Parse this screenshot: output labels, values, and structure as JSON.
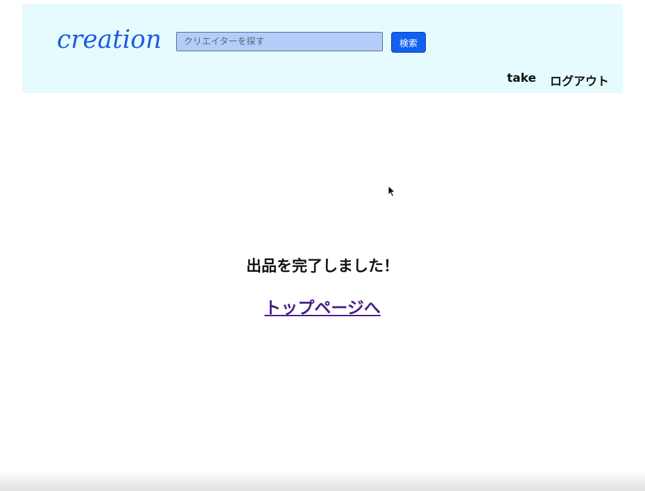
{
  "header": {
    "logo_text": "creation",
    "search": {
      "placeholder": "クリエイターを探す",
      "value": ""
    },
    "search_button_label": "検索",
    "nav": {
      "username": "take",
      "logout_label": "ログアウト"
    }
  },
  "main": {
    "message": "出品を完了しました！",
    "top_link_label": "トップページへ"
  },
  "colors": {
    "header_bg": "#e5fbfd",
    "logo": "#1f5ae0",
    "search_input_bg": "#b3cdfb",
    "search_button_bg": "#1160f3",
    "link_visited": "#4a1d86"
  },
  "icons": {
    "cursor": "mouse-pointer-icon"
  }
}
